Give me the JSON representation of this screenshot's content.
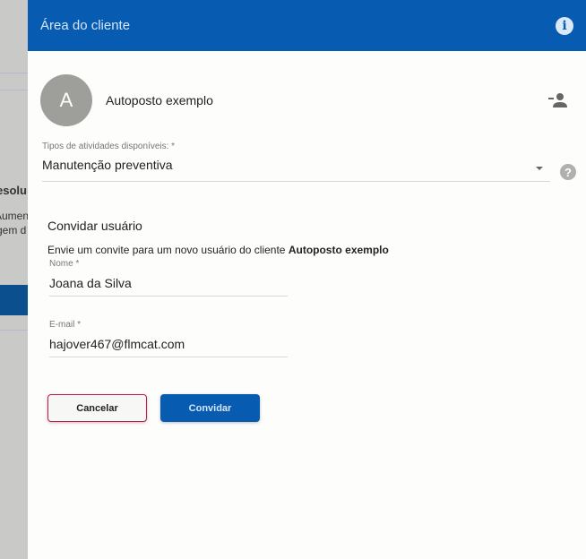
{
  "background": {
    "fragments": [
      "esolu",
      "Aumen",
      "gem d"
    ]
  },
  "header": {
    "title": "Área do cliente",
    "info_icon": "i"
  },
  "client": {
    "avatar_letter": "A",
    "name": "Autoposto exemplo"
  },
  "activity_select": {
    "label": "Tipos de atividades disponíveis: *",
    "value": "Manutenção preventiva",
    "help_icon": "?"
  },
  "invite": {
    "title": "Convidar usuário",
    "description": "Envie um convite para um novo usuário do cliente ",
    "client_name": "Autoposto exemplo",
    "name_label": "Nome *",
    "name_value": "Joana da Silva",
    "email_label": "E-mail *",
    "email_value": "hajover467@flmcat.com"
  },
  "buttons": {
    "cancel": "Cancelar",
    "invite": "Convidar"
  }
}
